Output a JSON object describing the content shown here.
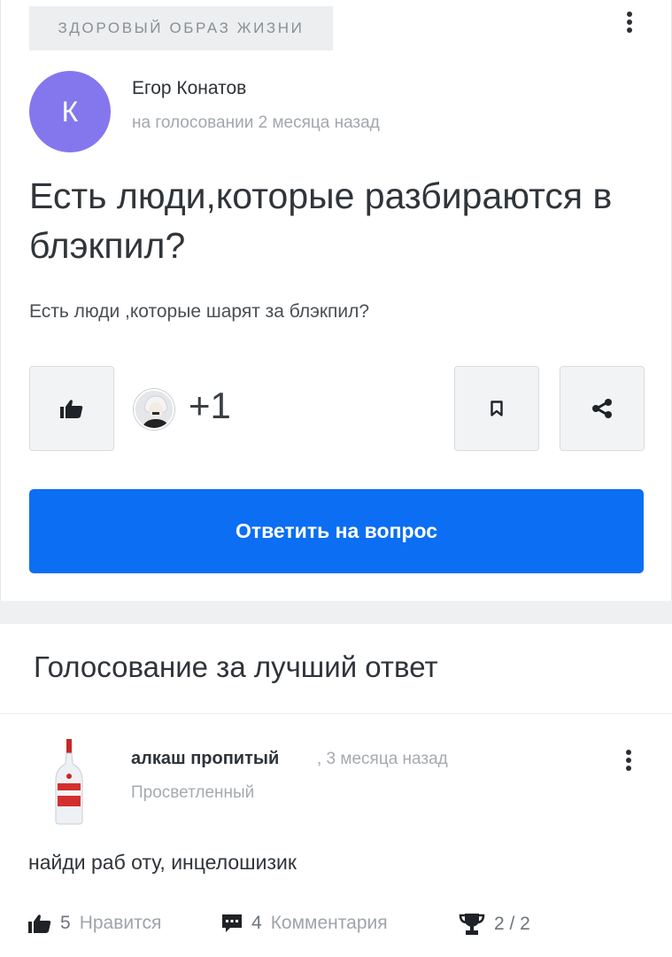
{
  "question": {
    "category": "Здоровый образ жизни",
    "author": {
      "initial": "К",
      "name": "Егор Конатов",
      "meta": "на голосовании 2 месяца назад",
      "avatar_color": "#8477ee"
    },
    "title": "Есть люди,которые разбираются в блэкпил?",
    "body": "Есть люди ,которые шарят за блэкпил?",
    "likers_extra": "+1",
    "answer_button": "Ответить на вопрос"
  },
  "section": {
    "title": "Голосование за лучший ответ"
  },
  "answer": {
    "author": "алкаш пропитый",
    "time": ", 3 месяца назад",
    "rank": "Просветленный",
    "text": "найди раб оту, инцелошизик",
    "likes_count": "5",
    "likes_label": "Нравится",
    "comments_count": "4",
    "comments_label": "Комментария",
    "votes": "2 / 2"
  },
  "colors": {
    "accent": "#0b6ef3",
    "category_bg": "#eceef0",
    "muted_text": "#a3a7ac"
  },
  "icons": [
    "kebab-menu-icon",
    "thumbs-up-icon",
    "bookmark-icon",
    "share-icon",
    "comment-icon",
    "trophy-icon"
  ]
}
